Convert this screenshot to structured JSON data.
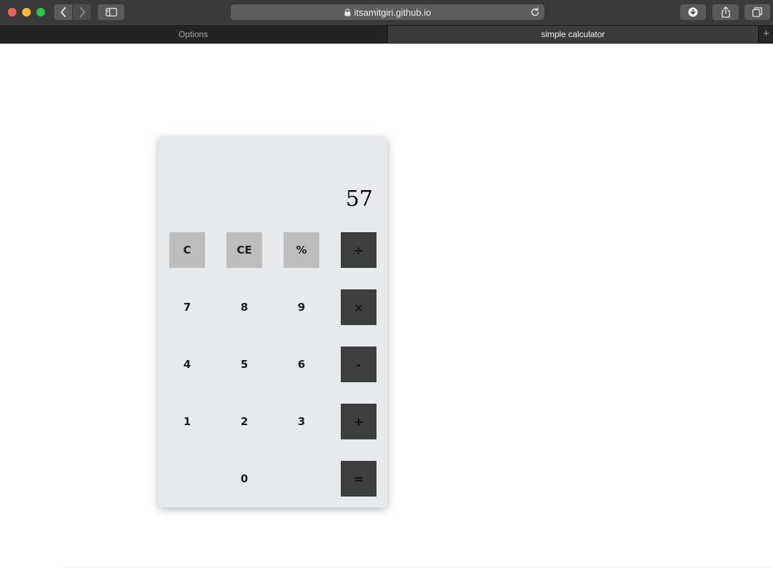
{
  "browser": {
    "url": "itsamitgiri.github.io",
    "tabs": [
      {
        "label": "Options",
        "active": false
      },
      {
        "label": "simple calculator",
        "active": true
      }
    ],
    "new_tab_label": "+"
  },
  "calculator": {
    "display": "57",
    "keys": {
      "clear": "C",
      "clear_entry": "CE",
      "percent": "%",
      "divide": "÷",
      "seven": "7",
      "eight": "8",
      "nine": "9",
      "multiply": "×",
      "four": "4",
      "five": "5",
      "six": "6",
      "subtract": "-",
      "one": "1",
      "two": "2",
      "three": "3",
      "add": "+",
      "zero": "0",
      "equals": "="
    }
  },
  "colors": {
    "function_key": "#bdbdbd",
    "operator_key": "#3c3f3e",
    "calculator_bg": "#e8ebee"
  }
}
